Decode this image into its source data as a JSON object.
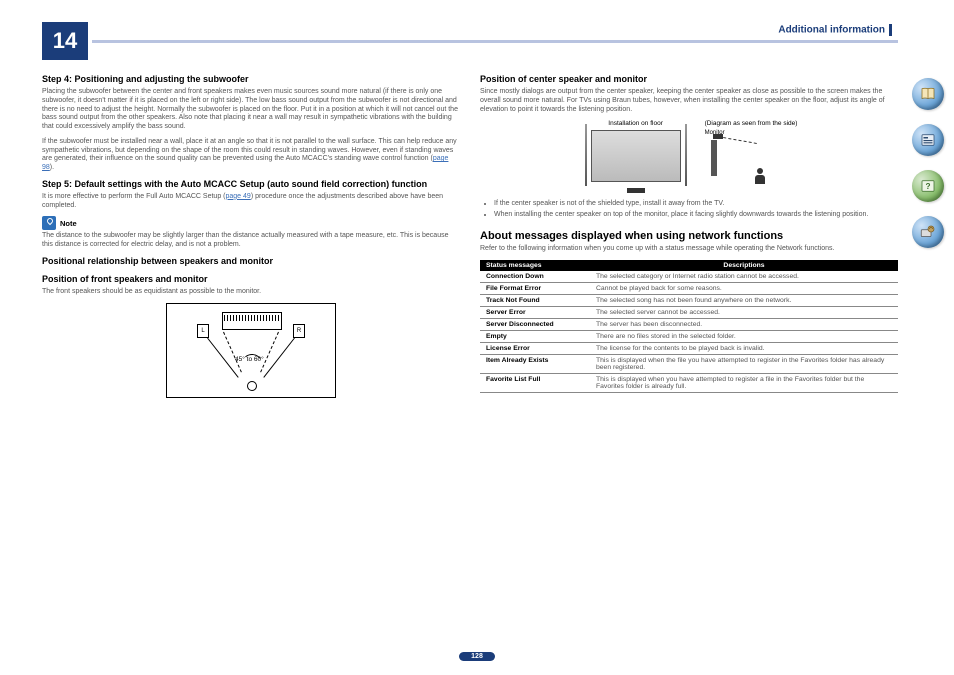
{
  "header": {
    "chapter_number": "14",
    "section_title": "Additional information"
  },
  "left": {
    "step4_title": "Step 4: Positioning and adjusting the subwoofer",
    "step4_p1": "Placing the subwoofer between the center and front speakers makes even music sources sound more natural (if there is only one subwoofer, it doesn't matter if it is placed on the left or right side). The low bass sound output from the subwoofer is not directional and there is no need to adjust the height. Normally the subwoofer is placed on the floor. Put it in a position at which it will not cancel out the bass sound output from the other speakers. Also note that placing it near a wall may result in sympathetic vibrations with the building that could excessively amplify the bass sound.",
    "step4_p2": "If the subwoofer must be installed near a wall, place it at an angle so that it is not parallel to the wall surface. This can help reduce any sympathetic vibrations, but depending on the shape of the room this could result in standing waves. However, even if standing waves are generated, their influence on the sound quality can be prevented using the Auto MCACC's standing wave control function (",
    "step4_link": "page 98",
    "step4_p2_end": ").",
    "step5_title": "Step 5: Default settings with the Auto MCACC Setup (auto sound field correction) function",
    "step5_p1a": "It is more effective to perform the Full Auto MCACC Setup (",
    "step5_link": "page 49",
    "step5_p1b": ") procedure once the adjustments described above have been completed.",
    "note_label": "Note",
    "note_text": "The distance to the subwoofer may be slightly larger than the distance actually measured with a tape measure, etc. This is because this distance is corrected for electric delay, and is not a problem.",
    "positional_title": "Positional relationship between speakers and monitor",
    "front_title": "Position of front speakers and monitor",
    "front_text": "The front speakers should be as equidistant as possible to the monitor.",
    "diagram_left": "L",
    "diagram_right": "R",
    "diagram_angle": "45° to 60°"
  },
  "right": {
    "center_title": "Position of center speaker and monitor",
    "center_text": "Since mostly dialogs are output from the center speaker, keeping the center speaker as close as possible to the screen makes the overall sound more natural. For TVs using Braun tubes, however, when installing the center speaker on the floor, adjust its angle of elevation to point it towards the listening position.",
    "install_label": "Installation on floor",
    "side_label": "(Diagram as seen from the side)",
    "monitor_label": "Monitor",
    "bullets": [
      "If the center speaker is not of the shielded type, install it away from the TV.",
      "When installing the center speaker on top of the monitor, place it facing slightly downwards towards the listening position."
    ],
    "network_title": "About messages displayed when using network functions",
    "network_intro": "Refer to the following information when you come up with a status message while operating the Network functions.",
    "table_headers": [
      "Status messages",
      "Descriptions"
    ],
    "table_rows": [
      {
        "msg": "Connection Down",
        "desc": "The selected category or Internet radio station cannot be accessed."
      },
      {
        "msg": "File Format Error",
        "desc": "Cannot be played back for some reasons."
      },
      {
        "msg": "Track Not Found",
        "desc": "The selected song has not been found anywhere on the network."
      },
      {
        "msg": "Server Error",
        "desc": "The selected server cannot be accessed."
      },
      {
        "msg": "Server Disconnected",
        "desc": "The server has been disconnected."
      },
      {
        "msg": "Empty",
        "desc": "There are no files stored in the selected folder."
      },
      {
        "msg": "License Error",
        "desc": "The license for the contents to be played back is invalid."
      },
      {
        "msg": "Item Already Exists",
        "desc": "This is displayed when the file you have attempted to register in the Favorites folder has already been registered."
      },
      {
        "msg": "Favorite List Full",
        "desc": "This is displayed when you have attempted to register a file in the Favorites folder but the Favorites folder is already full."
      }
    ]
  },
  "footer_page": "128",
  "side_nav": [
    "book-icon",
    "menu-icon",
    "help-icon",
    "av-icon"
  ]
}
